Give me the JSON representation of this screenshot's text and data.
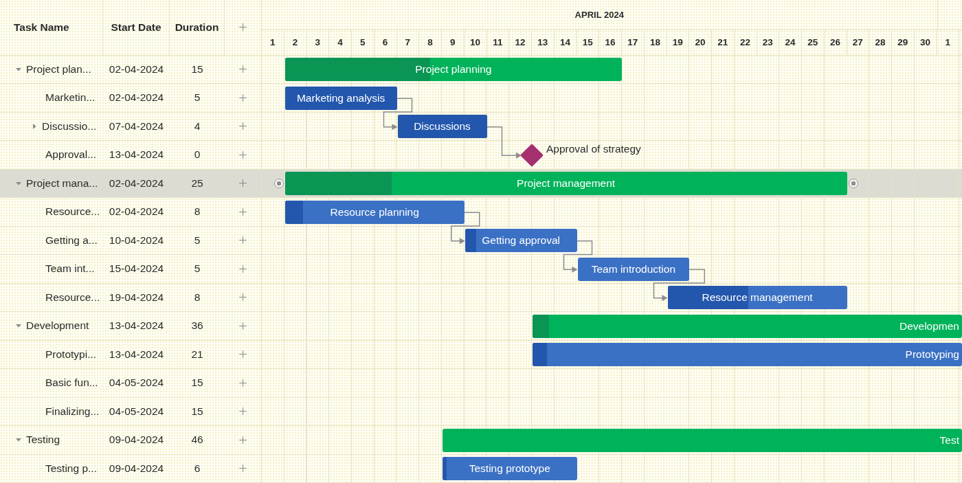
{
  "columns": [
    "Task Name",
    "Start Date",
    "Duration"
  ],
  "timeline": {
    "month": "APRIL 2024",
    "days": [
      "1",
      "2",
      "3",
      "4",
      "5",
      "6",
      "7",
      "8",
      "9",
      "10",
      "11",
      "12",
      "13",
      "14",
      "15",
      "16",
      "17",
      "18",
      "19",
      "20",
      "21",
      "22",
      "23",
      "24",
      "25",
      "26",
      "27",
      "28",
      "29",
      "30",
      "1"
    ]
  },
  "tasks": [
    {
      "kind": "group",
      "name": "Project plan...",
      "start": "02-04-2024",
      "duration": "15",
      "expanded": true,
      "selected": false,
      "bar_label": "Project planning",
      "level": 0.43,
      "children": [
        {
          "kind": "task",
          "name": "Marketin...",
          "start": "02-04-2024",
          "duration": "5",
          "selected": false,
          "bar_label": "Marketing analysis",
          "level": 1
        },
        {
          "kind": "task",
          "name": "Discussio...",
          "start": "07-04-2024",
          "duration": "4",
          "expanded": false,
          "selected": false,
          "bar_label": "Discussions",
          "level": 1,
          "linked": true
        },
        {
          "kind": "milestone",
          "name": "Approval...",
          "start": "13-04-2024",
          "duration": "0",
          "selected": false,
          "bar_label": "Approval of strategy",
          "linked": true
        }
      ]
    },
    {
      "kind": "group",
      "name": "Project mana...",
      "start": "02-04-2024",
      "duration": "25",
      "expanded": true,
      "selected": true,
      "bar_label": "Project management",
      "level": 0.19,
      "children": [
        {
          "kind": "task",
          "name": "Resource...",
          "start": "02-04-2024",
          "duration": "8",
          "selected": false,
          "bar_label": "Resource planning",
          "level": 0.1
        },
        {
          "kind": "task",
          "name": "Getting a...",
          "start": "10-04-2024",
          "duration": "5",
          "selected": false,
          "bar_label": "Getting approval",
          "level": 0.1,
          "linked": true
        },
        {
          "kind": "task",
          "name": "Team int...",
          "start": "15-04-2024",
          "duration": "5",
          "selected": false,
          "bar_label": "Team introduction",
          "linked": true
        },
        {
          "kind": "task",
          "name": "Resource...",
          "start": "19-04-2024",
          "duration": "8",
          "selected": false,
          "bar_label": "Resource management",
          "level": 0.45,
          "linked": true
        }
      ]
    },
    {
      "kind": "group",
      "name": "Development",
      "start": "13-04-2024",
      "duration": "36",
      "expanded": true,
      "selected": false,
      "bar_label": "Developmen",
      "level": 0.02,
      "children": [
        {
          "kind": "task",
          "name": "Prototypi...",
          "start": "13-04-2024",
          "duration": "21",
          "selected": false,
          "bar_label": "Prototyping",
          "level": 0.03
        },
        {
          "kind": "task",
          "name": "Basic fun...",
          "start": "04-05-2024",
          "duration": "15",
          "selected": false
        },
        {
          "kind": "task",
          "name": "Finalizing...",
          "start": "04-05-2024",
          "duration": "15",
          "selected": false
        }
      ]
    },
    {
      "kind": "group",
      "name": "Testing",
      "start": "09-04-2024",
      "duration": "46",
      "expanded": true,
      "selected": false,
      "bar_label": "Test",
      "children": [
        {
          "kind": "task",
          "name": "Testing p...",
          "start": "09-04-2024",
          "duration": "6",
          "selected": false,
          "bar_label": "Testing prototype",
          "level": 0.03
        }
      ]
    }
  ]
}
